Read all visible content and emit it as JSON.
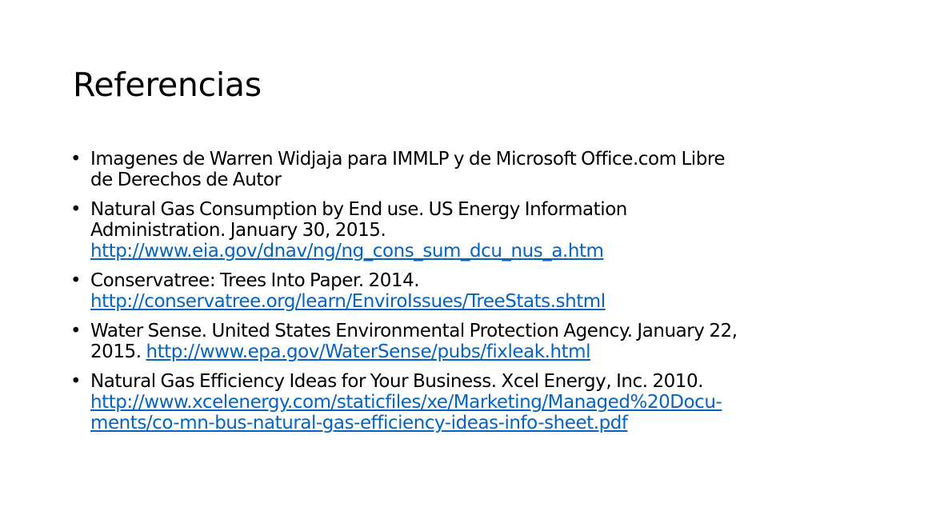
{
  "slide": {
    "title": "Referencias",
    "bullet_glyph": "•",
    "references": [
      {
        "line1": "Imagenes de Warren Widjaja para IMMLP y de Microsoft Office.com Libre",
        "line2": "de Derechos de Autor"
      },
      {
        "line1": "Natural Gas Consumption by End use. US Energy Information",
        "line2": "Administration. January 30, 2015.",
        "link": "http://www.eia.gov/dnav/ng/ng_cons_sum_dcu_nus_a.htm"
      },
      {
        "line1": "Conservatree: Trees Into Paper. 2014.",
        "link": "http://conservatree.org/learn/EnviroIssues/TreeStats.shtml"
      },
      {
        "line1": "Water Sense. United States Environmental Protection Agency. January 22,",
        "line2_prefix": "2015. ",
        "link": "http://www.epa.gov/WaterSense/pubs/fixleak.html"
      },
      {
        "line1": "Natural Gas Efficiency Ideas for Your Business. Xcel Energy, Inc. 2010.",
        "link_line1": "http://www.xcelenergy.com/staticfiles/xe/Marketing/Managed%20Docu-",
        "link_line2": "ments/co-mn-bus-natural-gas-efficiency-ideas-info-sheet.pdf"
      }
    ]
  }
}
